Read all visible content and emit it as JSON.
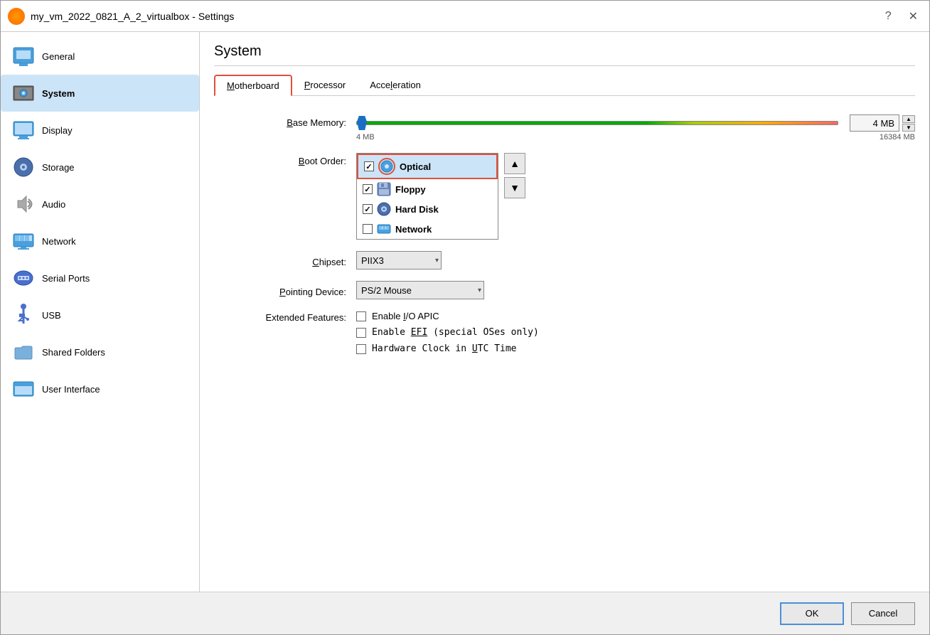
{
  "window": {
    "title": "my_vm_2022_0821_A_2_virtualbox - Settings",
    "icon": "🟠"
  },
  "sidebar": {
    "items": [
      {
        "label": "General",
        "icon": "general-icon",
        "active": false
      },
      {
        "label": "System",
        "icon": "system-icon",
        "active": true
      },
      {
        "label": "Display",
        "icon": "display-icon",
        "active": false
      },
      {
        "label": "Storage",
        "icon": "storage-icon",
        "active": false
      },
      {
        "label": "Audio",
        "icon": "audio-icon",
        "active": false
      },
      {
        "label": "Network",
        "icon": "network-icon",
        "active": false
      },
      {
        "label": "Serial Ports",
        "icon": "serial-icon",
        "active": false
      },
      {
        "label": "USB",
        "icon": "usb-icon",
        "active": false
      },
      {
        "label": "Shared Folders",
        "icon": "shared-icon",
        "active": false
      },
      {
        "label": "User Interface",
        "icon": "ui-icon",
        "active": false
      }
    ]
  },
  "main": {
    "panel_title": "System",
    "tabs": [
      {
        "label": "Motherboard",
        "underline_char": "M",
        "active": true
      },
      {
        "label": "Processor",
        "underline_char": "P",
        "active": false
      },
      {
        "label": "Acceleration",
        "underline_char": "l",
        "active": false
      }
    ],
    "motherboard": {
      "base_memory_label": "Base Memory:",
      "base_memory_value": "4 MB",
      "base_memory_min": "4 MB",
      "base_memory_max": "16384 MB",
      "boot_order_label": "Boot Order:",
      "boot_items": [
        {
          "label": "Optical",
          "checked": true,
          "selected": true
        },
        {
          "label": "Floppy",
          "checked": true,
          "selected": false
        },
        {
          "label": "Hard Disk",
          "checked": true,
          "selected": false
        },
        {
          "label": "Network",
          "checked": false,
          "selected": false
        }
      ],
      "chipset_label": "Chipset:",
      "chipset_value": "PIIX3",
      "pointing_device_label": "Pointing Device:",
      "pointing_device_value": "PS/2 Mouse",
      "extended_features_label": "Extended Features:",
      "checkbox_io_apic": "Enable I/O APIC",
      "checkbox_efi": "Enable EFI (special OSes only)",
      "checkbox_utc": "Hardware Clock in UTC Time",
      "io_apic_checked": false,
      "efi_checked": false,
      "utc_checked": false,
      "io_apic_underline": "I",
      "efi_underline": "EFI",
      "utc_underline": "U"
    }
  },
  "footer": {
    "ok_label": "OK",
    "cancel_label": "Cancel"
  }
}
